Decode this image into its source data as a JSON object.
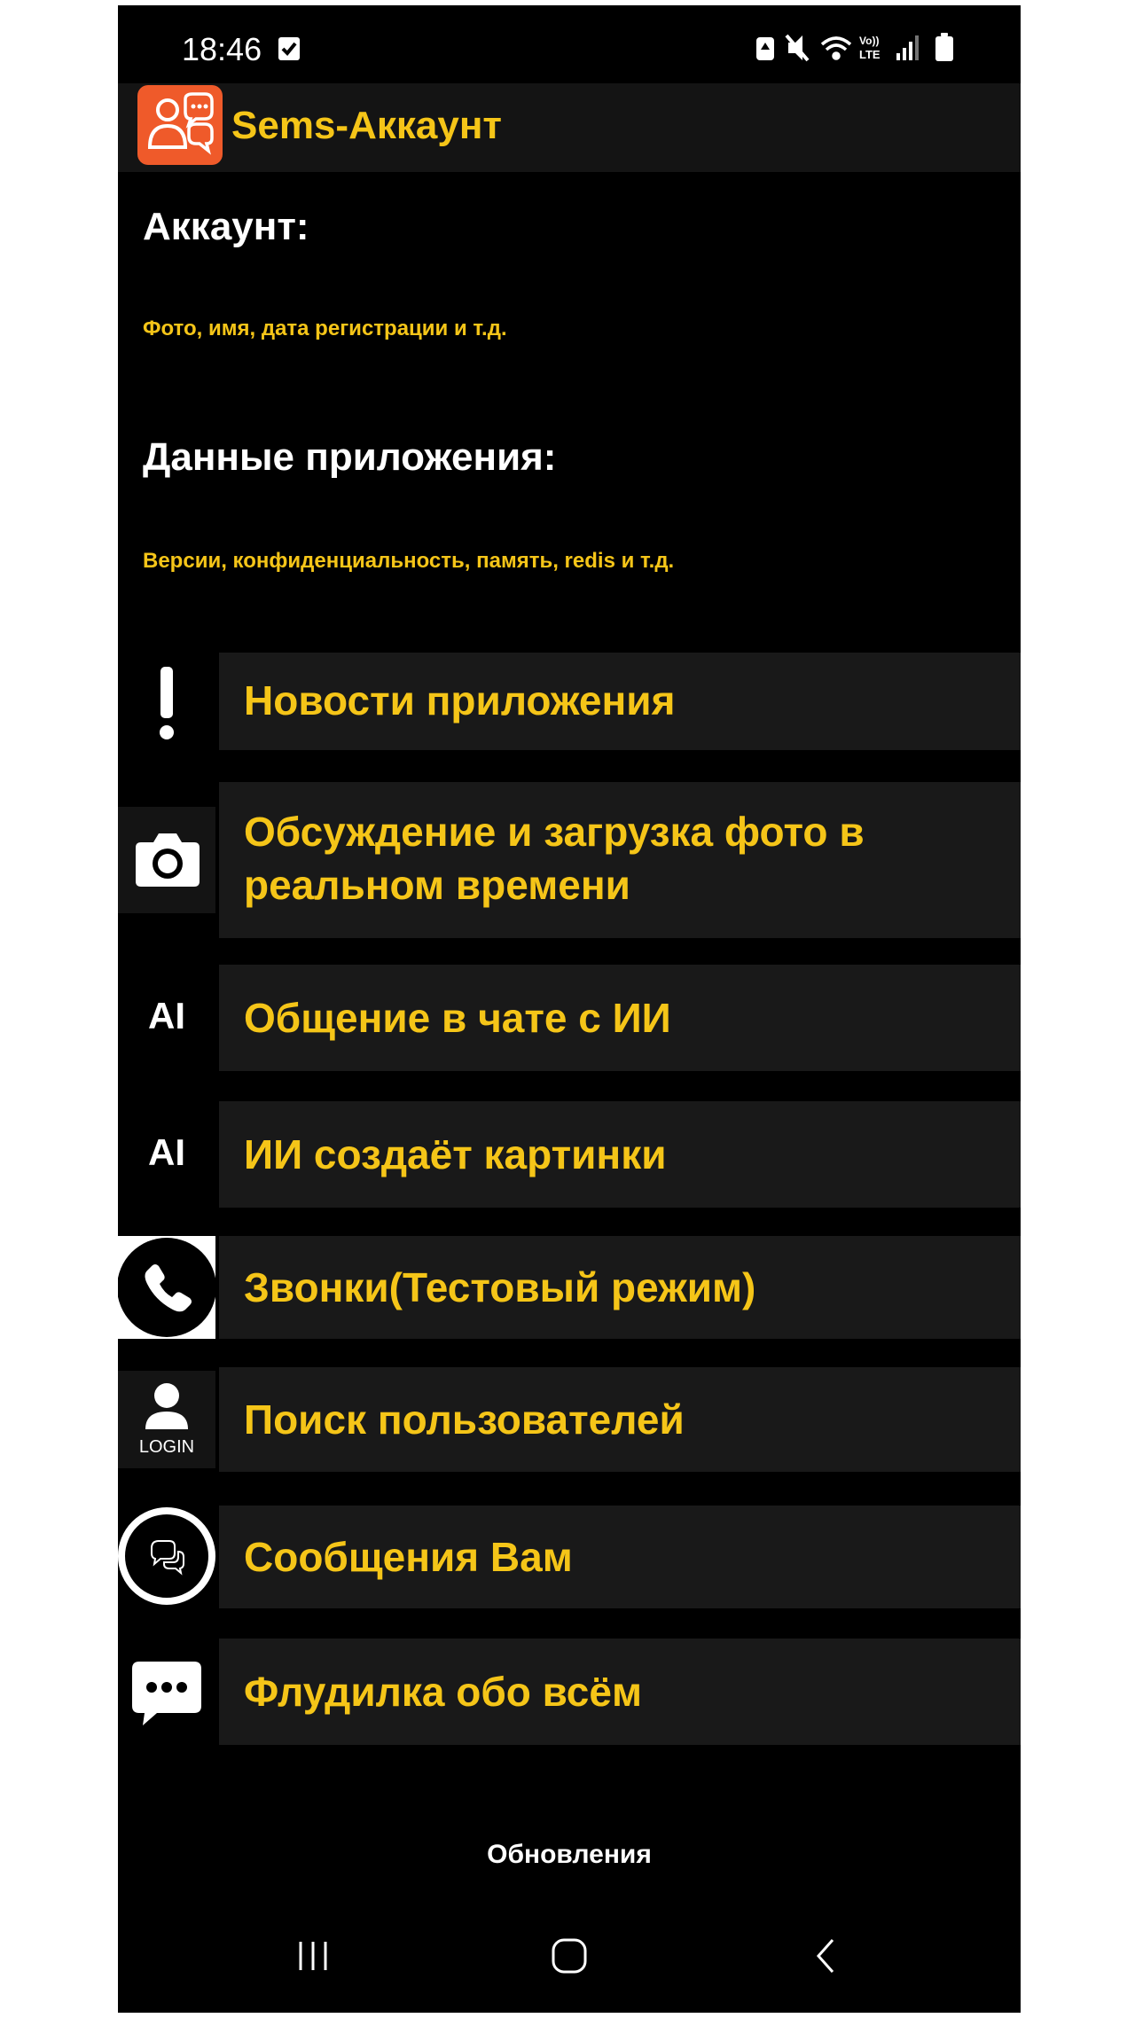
{
  "status_bar": {
    "time": "18:46",
    "network": "LTE",
    "volte_label": "Vo))",
    "icons": [
      "check-notification-icon",
      "battery-saver-icon",
      "mute-icon",
      "wifi-icon",
      "volte-icon",
      "signal-icon",
      "battery-icon"
    ]
  },
  "app_bar": {
    "logo_icon": "chat-people-logo",
    "title": "Sems-Аккаунт"
  },
  "account": {
    "heading": "Аккаунт:",
    "description": "Фото, имя, дата регистрации и т.д."
  },
  "app_data": {
    "heading": "Данные приложения:",
    "description": "Версии, конфиденциальность, память, redis и т.д."
  },
  "menu": {
    "items": [
      {
        "icon": "exclamation-icon",
        "label": "Новости приложения"
      },
      {
        "icon": "camera-icon",
        "label": "Обсуждение и загрузка фото в реальном времени"
      },
      {
        "icon": "ai-text-icon",
        "icon_text": "AI",
        "label": "Общение в чате с ИИ"
      },
      {
        "icon": "ai-text-icon",
        "icon_text": "AI",
        "label": "ИИ создаёт картинки"
      },
      {
        "icon": "phone-icon",
        "label": "Звонки(Тестовый режим)"
      },
      {
        "icon": "user-login-icon",
        "icon_text": "LOGIN",
        "label": "Поиск пользователей"
      },
      {
        "icon": "chat-bubbles-icon",
        "label": "Сообщения Вам"
      },
      {
        "icon": "speech-bubble-icon",
        "label": "Флудилка обо всём"
      }
    ]
  },
  "footer": {
    "updates_label": "Обновления"
  },
  "nav_bar": {
    "buttons": [
      "recent-apps-icon",
      "home-icon",
      "back-icon"
    ]
  },
  "colors": {
    "background": "#000000",
    "accent": "#f5c518",
    "card": "#191919",
    "logo": "#ef5a2a",
    "text": "#ffffff"
  }
}
